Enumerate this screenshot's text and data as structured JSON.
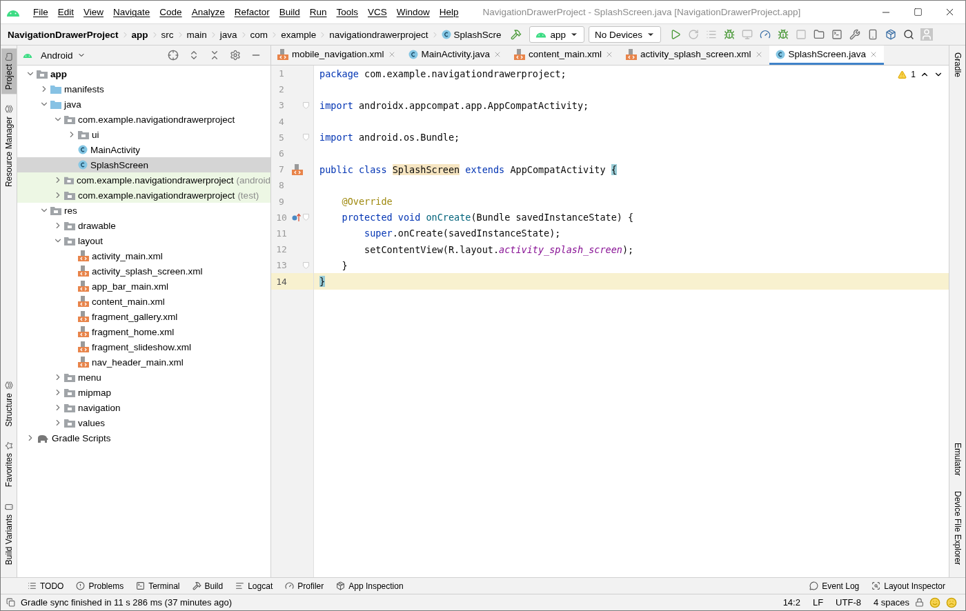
{
  "menu_bar": {
    "menus": [
      "File",
      "Edit",
      "View",
      "Navigate",
      "Code",
      "Analyze",
      "Refactor",
      "Build",
      "Run",
      "Tools",
      "VCS",
      "Window",
      "Help"
    ],
    "title": "NavigationDrawerProject - SplashScreen.java [NavigationDrawerProject.app]"
  },
  "breadcrumbs": [
    {
      "label": "NavigationDrawerProject",
      "kind": "project"
    },
    {
      "label": "app",
      "kind": "module"
    },
    {
      "label": "src",
      "kind": "dir"
    },
    {
      "label": "main",
      "kind": "dir"
    },
    {
      "label": "java",
      "kind": "dir"
    },
    {
      "label": "com",
      "kind": "dir"
    },
    {
      "label": "example",
      "kind": "dir"
    },
    {
      "label": "navigationdrawerproject",
      "kind": "dir"
    },
    {
      "label": "SplashScre",
      "kind": "class"
    }
  ],
  "run_config": {
    "module": "app",
    "device": "No Devices"
  },
  "left_stripe": {
    "top": [
      {
        "label": "Project",
        "selected": true
      },
      {
        "label": "Resource Manager",
        "selected": false
      }
    ],
    "bottom": [
      {
        "label": "Structure",
        "selected": false
      },
      {
        "label": "Favorites",
        "selected": false
      },
      {
        "label": "Build Variants",
        "selected": false
      }
    ]
  },
  "right_stripe": {
    "top": [
      "Gradle"
    ],
    "bottom": [
      "Emulator",
      "Device File Explorer"
    ]
  },
  "project_panel": {
    "view": "Android",
    "tree": [
      {
        "label": "app",
        "kind": "module",
        "expanded": true,
        "selected": false,
        "children": [
          {
            "label": "manifests",
            "kind": "source-folder",
            "expanded": false,
            "selected": false
          },
          {
            "label": "java",
            "kind": "source-folder",
            "expanded": true,
            "selected": false,
            "children": [
              {
                "label": "com.example.navigationdrawerproject",
                "kind": "package",
                "expanded": true,
                "selected": false,
                "children": [
                  {
                    "label": "ui",
                    "kind": "package",
                    "expanded": false,
                    "selected": false
                  },
                  {
                    "label": "MainActivity",
                    "kind": "class",
                    "selected": false
                  },
                  {
                    "label": "SplashScreen",
                    "kind": "class",
                    "selected": true
                  }
                ]
              },
              {
                "label": "com.example.navigationdrawerproject",
                "suffix": "(android",
                "kind": "test-package",
                "expanded": false,
                "selected": false
              },
              {
                "label": "com.example.navigationdrawerproject",
                "suffix": "(test)",
                "kind": "test-package",
                "expanded": false,
                "selected": false
              }
            ]
          },
          {
            "label": "res",
            "kind": "res-folder",
            "expanded": true,
            "selected": false,
            "children": [
              {
                "label": "drawable",
                "kind": "package",
                "expanded": false,
                "selected": false
              },
              {
                "label": "layout",
                "kind": "package",
                "expanded": true,
                "selected": false,
                "children": [
                  {
                    "label": "activity_main.xml",
                    "kind": "xml",
                    "selected": false
                  },
                  {
                    "label": "activity_splash_screen.xml",
                    "kind": "xml",
                    "selected": false
                  },
                  {
                    "label": "app_bar_main.xml",
                    "kind": "xml",
                    "selected": false
                  },
                  {
                    "label": "content_main.xml",
                    "kind": "xml",
                    "selected": false
                  },
                  {
                    "label": "fragment_gallery.xml",
                    "kind": "xml",
                    "selected": false
                  },
                  {
                    "label": "fragment_home.xml",
                    "kind": "xml",
                    "selected": false
                  },
                  {
                    "label": "fragment_slideshow.xml",
                    "kind": "xml",
                    "selected": false
                  },
                  {
                    "label": "nav_header_main.xml",
                    "kind": "xml",
                    "selected": false
                  }
                ]
              },
              {
                "label": "menu",
                "kind": "package",
                "expanded": false,
                "selected": false
              },
              {
                "label": "mipmap",
                "kind": "package",
                "expanded": false,
                "selected": false
              },
              {
                "label": "navigation",
                "kind": "package",
                "expanded": false,
                "selected": false
              },
              {
                "label": "values",
                "kind": "package",
                "expanded": false,
                "selected": false
              }
            ]
          }
        ]
      },
      {
        "label": "Gradle Scripts",
        "kind": "gradle",
        "expanded": false,
        "selected": false
      }
    ]
  },
  "editor": {
    "tabs": [
      {
        "label": "mobile_navigation.xml",
        "kind": "xml",
        "selected": false
      },
      {
        "label": "MainActivity.java",
        "kind": "class",
        "selected": false
      },
      {
        "label": "content_main.xml",
        "kind": "xml",
        "selected": false
      },
      {
        "label": "activity_splash_screen.xml",
        "kind": "xml",
        "selected": false
      },
      {
        "label": "SplashScreen.java",
        "kind": "class",
        "selected": true
      }
    ],
    "warnings": "1",
    "lines": [
      {
        "number": "1",
        "current": false,
        "tokens": [
          {
            "kind": "keyword",
            "text": "package"
          },
          {
            "kind": "plain",
            "text": " com.example.navigationdrawerproject;"
          }
        ]
      },
      {
        "number": "2",
        "current": false
      },
      {
        "number": "3",
        "current": false,
        "fold": true,
        "tokens": [
          {
            "kind": "keyword",
            "text": "import"
          },
          {
            "kind": "plain",
            "text": " androidx.appcompat.app.AppCompatActivity;"
          }
        ]
      },
      {
        "number": "4",
        "current": false
      },
      {
        "number": "5",
        "current": false,
        "fold": true,
        "tokens": [
          {
            "kind": "keyword",
            "text": "import"
          },
          {
            "kind": "plain",
            "text": " android.os.Bundle;"
          }
        ]
      },
      {
        "number": "6",
        "current": false
      },
      {
        "number": "7",
        "current": false,
        "gutter_icon": {
          "kind": "layout"
        },
        "tokens": [
          {
            "kind": "keyword",
            "text": "public class "
          },
          {
            "kind": "highlight",
            "text": "SplashScreen"
          },
          {
            "kind": "keyword",
            "text": " extends "
          },
          {
            "kind": "plain",
            "text": "AppCompatActivity "
          },
          {
            "kind": "brace-match",
            "text": "{"
          }
        ]
      },
      {
        "number": "8",
        "current": false
      },
      {
        "number": "9",
        "current": false,
        "tokens": [
          {
            "kind": "annotation",
            "text": "    @Override"
          }
        ]
      },
      {
        "number": "10",
        "current": false,
        "fold": true,
        "gutter_icon": {
          "kind": "override"
        },
        "tokens": [
          {
            "kind": "keyword",
            "text": "    protected void "
          },
          {
            "kind": "method",
            "text": "onCreate"
          },
          {
            "kind": "plain",
            "text": "(Bundle savedInstanceState) {"
          }
        ]
      },
      {
        "number": "11",
        "current": false,
        "tokens": [
          {
            "kind": "keyword",
            "text": "        super"
          },
          {
            "kind": "plain",
            "text": ".onCreate(savedInstanceState);"
          }
        ]
      },
      {
        "number": "12",
        "current": false,
        "tokens": [
          {
            "kind": "plain",
            "text": "        setContentView(R.layout."
          },
          {
            "kind": "field",
            "text": "activity_splash_screen"
          },
          {
            "kind": "plain",
            "text": ");"
          }
        ]
      },
      {
        "number": "13",
        "current": false,
        "fold": true,
        "tokens": [
          {
            "kind": "plain",
            "text": "    }"
          }
        ]
      },
      {
        "number": "14",
        "current": true,
        "tokens": [
          {
            "kind": "brace-match",
            "text": "}"
          }
        ]
      }
    ]
  },
  "tool_windows": {
    "left": [
      {
        "label": "TODO",
        "kind": "todo"
      },
      {
        "label": "Problems",
        "kind": "problems"
      },
      {
        "label": "Terminal",
        "kind": "terminal"
      },
      {
        "label": "Build",
        "kind": "build"
      },
      {
        "label": "Logcat",
        "kind": "logcat"
      },
      {
        "label": "Profiler",
        "kind": "profiler"
      },
      {
        "label": "App Inspection",
        "kind": "inspection"
      }
    ],
    "right": [
      {
        "label": "Event Log",
        "kind": "event-log"
      },
      {
        "label": "Layout Inspector",
        "kind": "layout-inspector"
      }
    ]
  },
  "status_bar": {
    "message": "Gradle sync finished in 11 s 286 ms (37 minutes ago)",
    "items": [
      "14:2",
      "LF",
      "UTF-8",
      "4 spaces"
    ]
  }
}
